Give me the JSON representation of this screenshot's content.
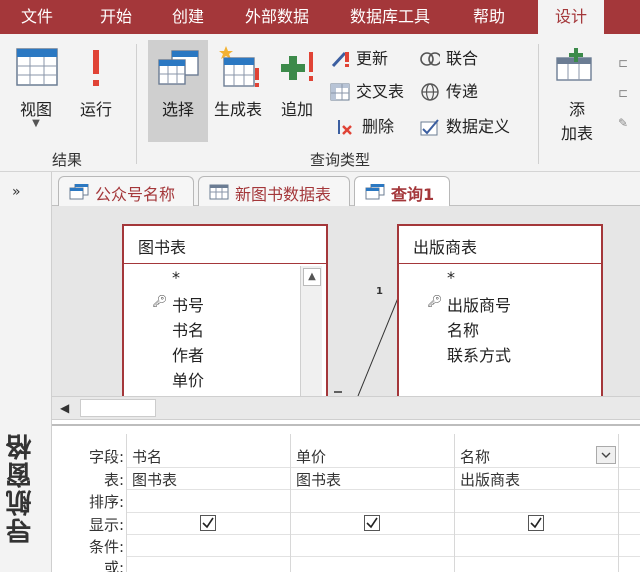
{
  "menubar": {
    "items": [
      "文件",
      "开始",
      "创建",
      "外部数据",
      "数据库工具",
      "帮助",
      "设计"
    ],
    "active_index": 6
  },
  "ribbon": {
    "results_group": {
      "label": "结果",
      "view_label": "视图",
      "run_label": "运行"
    },
    "query_type_group": {
      "label": "查询类型",
      "select_label": "选择",
      "make_table_label": "生成表",
      "append_label": "追加",
      "update_label": "更新",
      "crosstab_label": "交叉表",
      "delete_label": "删除",
      "union_label": "联合",
      "pass_through_label": "传递",
      "data_definition_label": "数据定义"
    },
    "setup_group": {
      "add_table_label_line1": "添",
      "add_table_label_line2": "加表"
    }
  },
  "nav_pane": {
    "toggle": "»",
    "title": "导航窗格"
  },
  "doc_tabs": [
    {
      "label": "公众号名称",
      "icon": "query-icon"
    },
    {
      "label": "新图书数据表",
      "icon": "table-icon"
    },
    {
      "label": "查询1",
      "icon": "query-icon"
    }
  ],
  "design": {
    "tables": [
      {
        "name": "图书表",
        "fields": [
          "*",
          "书号",
          "书名",
          "作者",
          "单价"
        ],
        "key_field_index": 1
      },
      {
        "name": "出版商表",
        "fields": [
          "*",
          "出版商号",
          "名称",
          "联系方式"
        ],
        "key_field_index": 1
      }
    ],
    "join_label": "1"
  },
  "qbe_grid": {
    "row_headers": [
      "字段:",
      "表:",
      "排序:",
      "显示:",
      "条件:",
      "或:"
    ],
    "columns": [
      {
        "field": "书名",
        "table": "图书表",
        "show": true
      },
      {
        "field": "单价",
        "table": "图书表",
        "show": true
      },
      {
        "field": "名称",
        "table": "出版商表",
        "show": true
      }
    ]
  },
  "colors": {
    "brand": "#a4373a",
    "ribbon_bg": "#f3f3f3",
    "design_bg": "#e6e6e6"
  }
}
